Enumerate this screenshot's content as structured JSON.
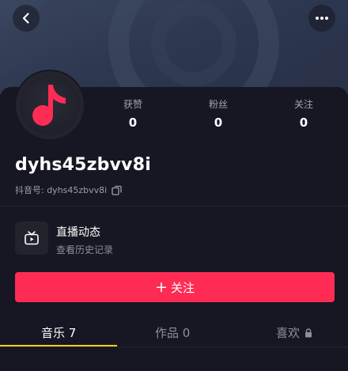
{
  "header": {
    "back_icon": "chevron-left-icon",
    "more_icon": "more-dots-icon"
  },
  "profile": {
    "avatar_icon": "music-note-icon",
    "username": "dyhs45zbvv8i",
    "id_label": "抖音号: dyhs45zbvv8i",
    "copy_icon": "copy-icon",
    "stats": [
      {
        "label": "获赞",
        "value": "0"
      },
      {
        "label": "粉丝",
        "value": "0"
      },
      {
        "label": "关注",
        "value": "0"
      }
    ]
  },
  "live": {
    "icon": "tv-icon",
    "title": "直播动态",
    "subtitle": "查看历史记录"
  },
  "follow": {
    "plus": "+",
    "label": "关注"
  },
  "tabs": [
    {
      "label": "音乐 7",
      "active": true
    },
    {
      "label": "作品 0",
      "active": false
    },
    {
      "label": "喜欢",
      "active": false,
      "icon": "lock-icon"
    }
  ],
  "colors": {
    "accent": "#fe2c55",
    "tab_indicator": "#face15",
    "background": "#161722"
  }
}
